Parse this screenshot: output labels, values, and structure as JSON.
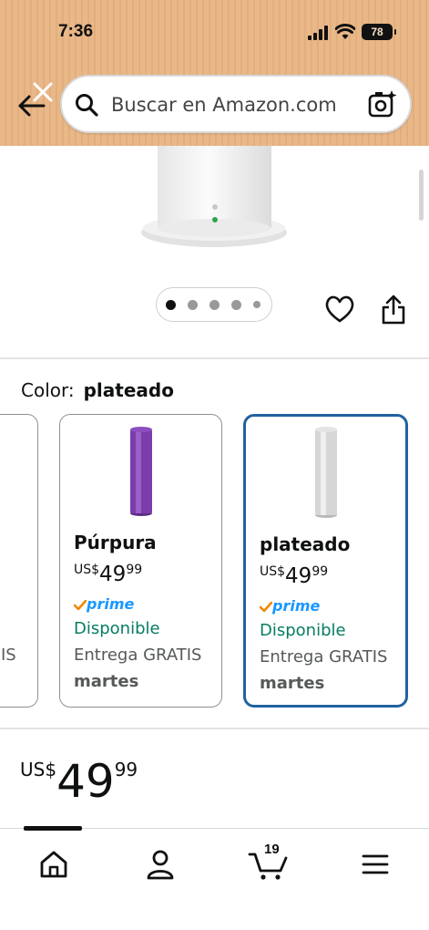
{
  "status_bar": {
    "time": "7:36",
    "battery": "78"
  },
  "search": {
    "placeholder": "Buscar en Amazon.com"
  },
  "carousel": {
    "total_images": 5,
    "active_index": 0
  },
  "color_selector": {
    "label": "Color:",
    "selected": "plateado"
  },
  "variants": [
    {
      "name": "",
      "price_currency": "",
      "price_whole": "",
      "price_fraction": "",
      "prime": "",
      "availability": "",
      "delivery_fragment": "IS",
      "delivery_day": ""
    },
    {
      "name": "Púrpura",
      "price_currency": "US$",
      "price_whole": "49",
      "price_fraction": "99",
      "prime": "prime",
      "availability": "Disponible",
      "delivery": "Entrega GRATIS",
      "delivery_day": "martes",
      "swatch_color": "#7a3ea8"
    },
    {
      "name": "plateado",
      "price_currency": "US$",
      "price_whole": "49",
      "price_fraction": "99",
      "prime": "prime",
      "availability": "Disponible",
      "delivery": "Entrega GRATIS",
      "delivery_day": "martes",
      "swatch_color": "#d6d6d6",
      "selected": true
    }
  ],
  "main_price": {
    "currency": "US$",
    "whole": "49",
    "fraction": "99"
  },
  "tabbar": {
    "cart_count": "19",
    "items": [
      "home-icon",
      "account-icon",
      "cart-icon",
      "menu-icon"
    ]
  },
  "colors": {
    "header": "#e9b888",
    "selected_border": "#2162a1",
    "prime_blue": "#1a98ff",
    "available_green": "#067d62"
  }
}
